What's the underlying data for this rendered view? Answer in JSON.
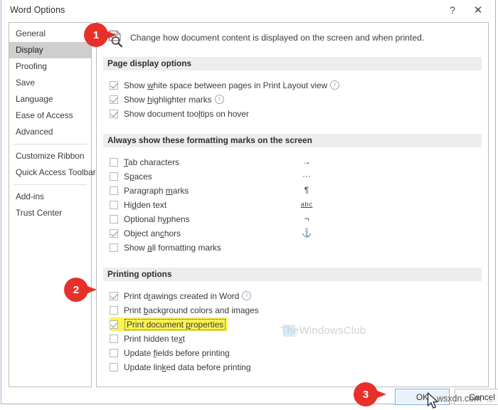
{
  "window": {
    "title": "Word Options",
    "help_icon": "?",
    "close_icon": "✕"
  },
  "sidebar": {
    "groups": [
      {
        "items": [
          {
            "label": "General",
            "selected": false
          },
          {
            "label": "Display",
            "selected": true
          },
          {
            "label": "Proofing",
            "selected": false
          },
          {
            "label": "Save",
            "selected": false
          },
          {
            "label": "Language",
            "selected": false
          },
          {
            "label": "Ease of Access",
            "selected": false
          },
          {
            "label": "Advanced",
            "selected": false
          }
        ]
      },
      {
        "items": [
          {
            "label": "Customize Ribbon",
            "selected": false
          },
          {
            "label": "Quick Access Toolbar",
            "selected": false
          }
        ]
      },
      {
        "items": [
          {
            "label": "Add-ins",
            "selected": false
          },
          {
            "label": "Trust Center",
            "selected": false
          }
        ]
      }
    ]
  },
  "content": {
    "intro": "Change how document content is displayed on the screen and when printed.",
    "intro_icon": "document-magnifier-icon",
    "sections": [
      {
        "id": "page-display-options",
        "heading": "Page display options",
        "options": [
          {
            "label_pre": "Show ",
            "accel": "w",
            "label_post": "hite space between pages in Print Layout view",
            "checked": true,
            "info": true
          },
          {
            "label_pre": "Show ",
            "accel": "h",
            "label_post": "ighlighter marks",
            "checked": true,
            "info": true
          },
          {
            "label_pre": "Show document too",
            "accel": "l",
            "label_post": "tips on hover",
            "checked": true,
            "info": false
          }
        ]
      },
      {
        "id": "formatting-marks",
        "heading": "Always show these formatting marks on the screen",
        "options": [
          {
            "label_pre": "",
            "accel": "T",
            "label_post": "ab characters",
            "checked": false,
            "glyph": "→",
            "glyph_name": "tab-arrow-icon"
          },
          {
            "label_pre": "S",
            "accel": "p",
            "label_post": "aces",
            "checked": false,
            "glyph": "···",
            "glyph_name": "space-dots-icon"
          },
          {
            "label_pre": "Paragraph ",
            "accel": "m",
            "label_post": "arks",
            "checked": false,
            "glyph": "¶",
            "glyph_name": "pilcrow-icon"
          },
          {
            "label_pre": "Hi",
            "accel": "d",
            "label_post": "den text",
            "checked": false,
            "glyph": "abc",
            "glyph_name": "hidden-text-icon"
          },
          {
            "label_pre": "Optional h",
            "accel": "y",
            "label_post": "phens",
            "checked": false,
            "glyph": "¬",
            "glyph_name": "optional-hyphen-icon"
          },
          {
            "label_pre": "Object an",
            "accel": "c",
            "label_post": "hors",
            "checked": true,
            "glyph": "⚓",
            "glyph_name": "anchor-icon"
          },
          {
            "label_pre": "Show ",
            "accel": "a",
            "label_post": "ll formatting marks",
            "checked": false,
            "glyph": "",
            "glyph_name": ""
          }
        ]
      },
      {
        "id": "printing-options",
        "heading": "Printing options",
        "options": [
          {
            "label_pre": "Print d",
            "accel": "r",
            "label_post": "awings created in Word",
            "checked": true,
            "info": true
          },
          {
            "label_pre": "Print ",
            "accel": "b",
            "label_post": "ackground colors and images",
            "checked": false,
            "info": false
          },
          {
            "label_pre": "Print document ",
            "accel": "p",
            "label_post": "roperties",
            "checked": true,
            "info": false,
            "highlighted": true
          },
          {
            "label_pre": "Print hidden te",
            "accel": "x",
            "label_post": "t",
            "checked": false,
            "info": false
          },
          {
            "label_pre": "Update ",
            "accel": "f",
            "label_post": "ields before printing",
            "checked": false,
            "info": false
          },
          {
            "label_pre": "Update lin",
            "accel": "k",
            "label_post": "ed data before printing",
            "checked": false,
            "info": false
          }
        ]
      }
    ]
  },
  "footer": {
    "ok_label": "OK",
    "cancel_label": "Cancel"
  },
  "callouts": [
    {
      "number": "1"
    },
    {
      "number": "2"
    },
    {
      "number": "3"
    }
  ],
  "watermarks": {
    "primary": "TheWindowsClub",
    "secondary": "wsxdn.com"
  },
  "colors": {
    "callout_red": "#e8302a",
    "highlight_yellow": "#fbf254",
    "selection_gray": "#cecece",
    "section_band": "#eceded",
    "focus_blue": "#7aa7d6"
  }
}
